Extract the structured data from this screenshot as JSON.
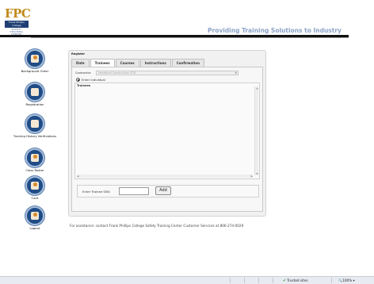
{
  "logo": {
    "letters": "FPC",
    "name_line1": "Frank Phillips",
    "name_line2": "College",
    "sub": "SAFETY TRAINING CENTER"
  },
  "header": {
    "tagline": "Providing Training Solutions to Industry"
  },
  "sidebar": {
    "items": [
      {
        "label": "Background Order",
        "icon": "person-icon"
      },
      {
        "label": "Registration",
        "icon": "envelope-icon"
      },
      {
        "label": "Training History Verifications",
        "icon": "document-icon"
      },
      {
        "label": "Class Roster",
        "icon": "roster-icon"
      },
      {
        "label": "Card",
        "icon": "id-card-icon"
      },
      {
        "label": "Logout",
        "icon": "logout-icon"
      }
    ]
  },
  "register": {
    "title": "Register",
    "tabs": [
      "Date",
      "Trainees",
      "Courses",
      "Instructions",
      "Confirmation"
    ],
    "active_tab": "Trainees",
    "contractor_label": "Contractor:",
    "contractor_value": "Heartland Construction STB",
    "enter_individual_label": "Enter individual",
    "trainees_title": "Trainees",
    "enter_trainee_label": "Enter Trainee SSN:",
    "trainee_ssn_value": "",
    "add_label": "Add"
  },
  "footer": {
    "assistance": "For assistance: contact Frank Phillips College Safety Training Center Customer Services at 806-274-0029"
  },
  "statusbar": {
    "trusted_sites": "Trusted sites",
    "zoom": "100%"
  }
}
